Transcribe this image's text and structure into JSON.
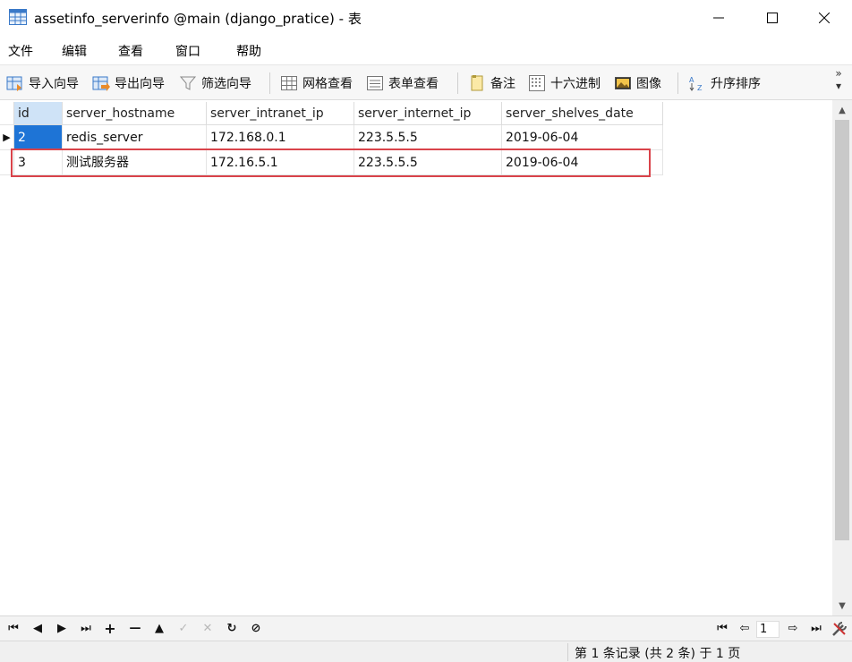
{
  "window": {
    "title": "assetinfo_serverinfo @main (django_pratice) - 表",
    "minimize": "—",
    "maximize": "☐",
    "close": "✕"
  },
  "menu": [
    "文件",
    "编辑",
    "查看",
    "窗口",
    "帮助"
  ],
  "toolbar": {
    "import_wizard": "导入向导",
    "export_wizard": "导出向导",
    "filter_wizard": "筛选向导",
    "grid_view": "网格查看",
    "form_view": "表单查看",
    "memo": "备注",
    "hex": "十六进制",
    "image": "图像",
    "sort_asc": "升序排序",
    "more": "»"
  },
  "table": {
    "columns": [
      "id",
      "server_hostname",
      "server_intranet_ip",
      "server_internet_ip",
      "server_shelves_date"
    ],
    "rows": [
      [
        "2",
        "redis_server",
        "172.168.0.1",
        "223.5.5.5",
        "2019-06-04"
      ],
      [
        "3",
        "测试服务器",
        "172.16.5.1",
        "223.5.5.5",
        "2019-06-04"
      ]
    ],
    "current_row_marker": "▶"
  },
  "navigator": {
    "first": "⏮",
    "prev": "◀",
    "next": "▶",
    "last": "⏭",
    "add": "+",
    "delete": "—",
    "up": "▲",
    "apply": "✓",
    "cancel": "✕",
    "refresh": "↻",
    "stop": "⊘",
    "page_first": "⏮",
    "page_prev": "⇦",
    "page_value": "1",
    "page_next": "⇨",
    "page_last": "⏭"
  },
  "status": {
    "text": "第 1 条记录 (共 2 条) 于 1 页"
  },
  "colors": {
    "selection": "#1e74d6",
    "highlight_box": "#d9434a",
    "header_highlight": "#cfe3f7"
  }
}
